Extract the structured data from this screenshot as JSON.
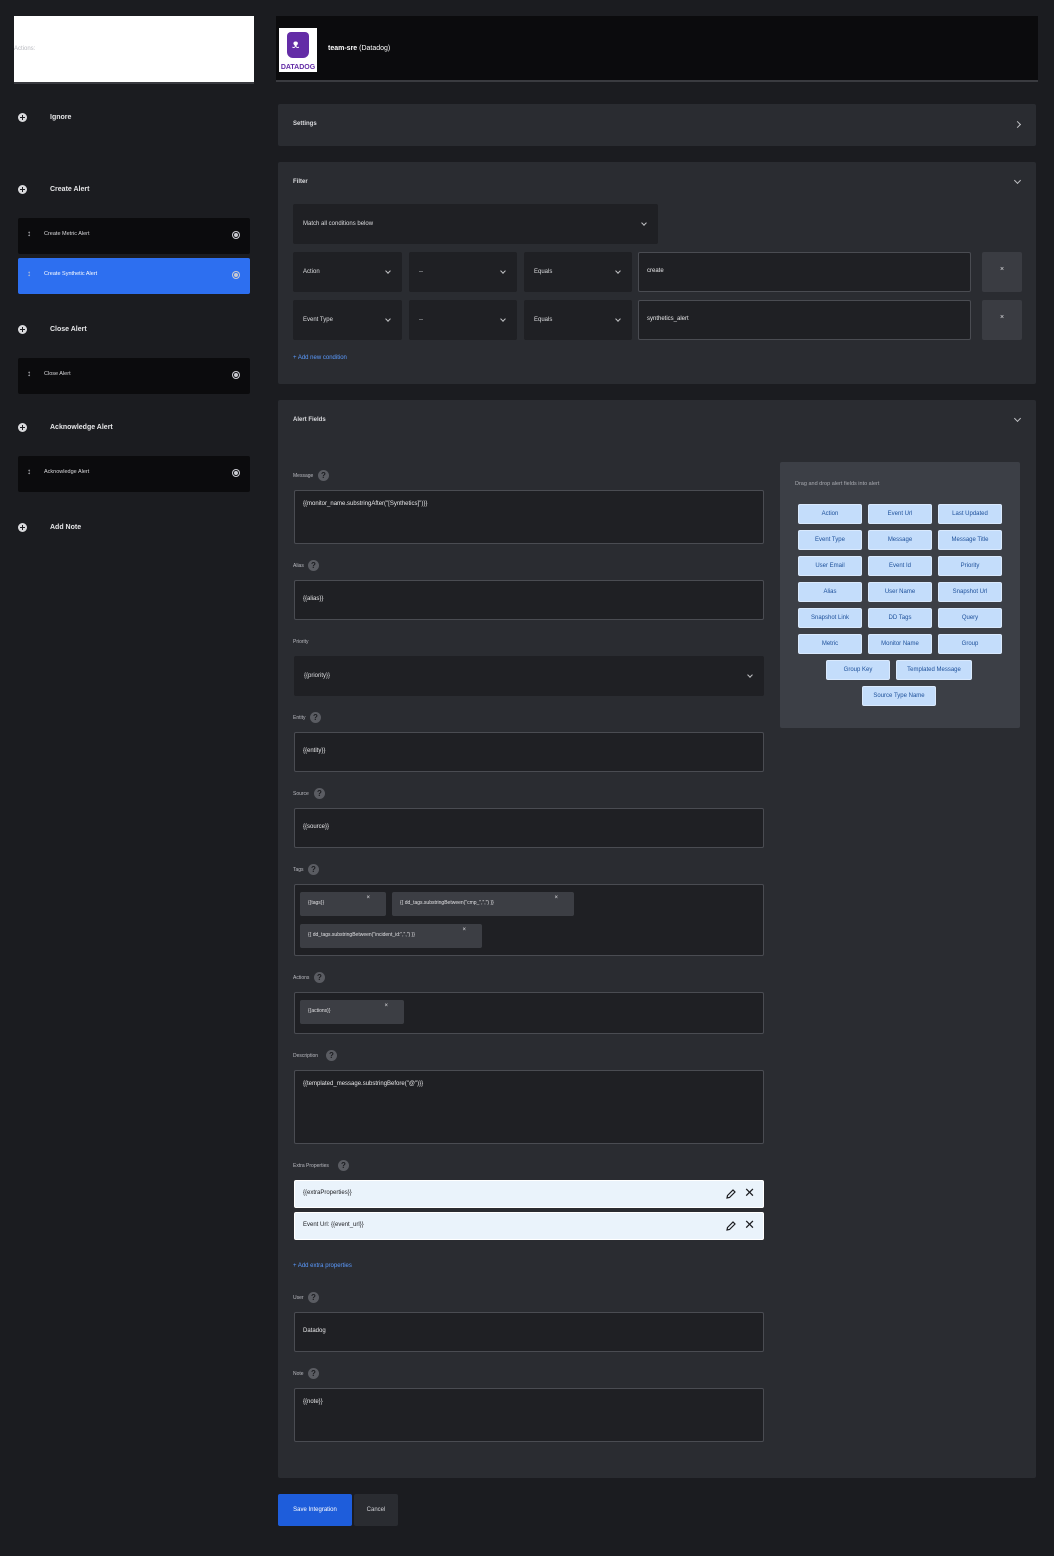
{
  "sidebar": {
    "actions_label": "Actions:",
    "groups": [
      {
        "label": "Ignore",
        "items": []
      },
      {
        "label": "Create Alert",
        "items": [
          "Create Metric Alert",
          "Create Synthetic Alert"
        ]
      },
      {
        "label": "Close Alert",
        "items": [
          "Close Alert"
        ]
      },
      {
        "label": "Acknowledge Alert",
        "items": [
          "Acknowledge Alert"
        ]
      },
      {
        "label": "Add Note",
        "items": []
      }
    ],
    "active_item": "Create Synthetic Alert"
  },
  "header": {
    "team": "team-sre",
    "integration": "(Datadog)",
    "logo_text": "DATADOG"
  },
  "settings": {
    "title": "Settings"
  },
  "filter": {
    "title": "Filter",
    "match_select": "Match all conditions below",
    "conditions": [
      {
        "field": "Action",
        "sub": "--",
        "operator": "Equals",
        "value": "create",
        "remove": "×"
      },
      {
        "field": "Event Type",
        "sub": "--",
        "operator": "Equals",
        "value": "synthetics_alert",
        "remove": "×"
      }
    ],
    "add_condition": "+ Add new condition"
  },
  "alert_fields": {
    "title": "Alert Fields",
    "message": {
      "label": "Message",
      "value": "{{monitor_name.substringAfter(\"[Synthetics]\")}}"
    },
    "alias": {
      "label": "Alias",
      "value": "{{alias}}"
    },
    "priority": {
      "label": "Priority",
      "value": "{{priority}}"
    },
    "entity": {
      "label": "Entity",
      "value": "{{entity}}"
    },
    "source": {
      "label": "Source",
      "value": "{{source}}"
    },
    "tags": {
      "label": "Tags",
      "chips": [
        "{{tags}}",
        "{{ dd_tags.substringBetween(\"cmp_\",\",\") }}",
        "{{ dd_tags.substringBetween(\"incident_id:\",\",\") }}"
      ]
    },
    "actions": {
      "label": "Actions",
      "chips": [
        "{{actions}}"
      ]
    },
    "description": {
      "label": "Description",
      "value": "{{templated_message.substringBefore(\"@\")}}"
    },
    "extra_properties": {
      "label": "Extra Properties",
      "items": [
        "{{extraProperties}}",
        "Event Url: {{event_url}}"
      ],
      "add_label": "+ Add extra properties"
    },
    "user": {
      "label": "User",
      "value": "Datadog"
    },
    "note": {
      "label": "Note",
      "value": "{{note}}"
    },
    "help_glyph": "?"
  },
  "drag_panel": {
    "hint": "Drag and drop alert fields into alert",
    "fields": [
      "Action",
      "Event Url",
      "Last Updated",
      "Event Type",
      "Message",
      "Message Title",
      "User Email",
      "Event Id",
      "Priority",
      "Alias",
      "User Name",
      "Snapshot Url",
      "Snapshot Link",
      "DD Tags",
      "Query",
      "Metric",
      "Monitor Name",
      "Group",
      "Group Key",
      "Templated Message",
      "Source Type Name"
    ]
  },
  "footer": {
    "save_label": "Save Integration",
    "cancel_label": "Cancel"
  }
}
